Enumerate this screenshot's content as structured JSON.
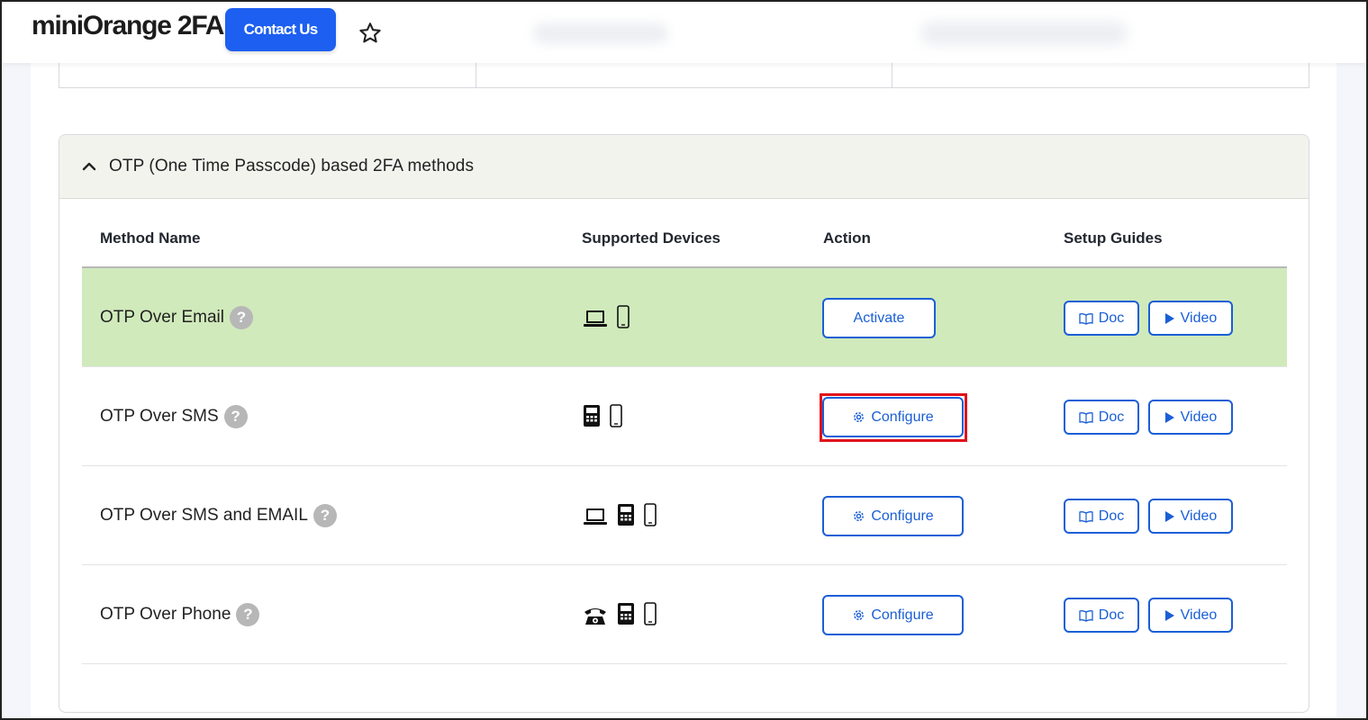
{
  "header": {
    "brand": "miniOrange 2FA",
    "contact_label": "Contact Us",
    "accent": "#1d5ff0"
  },
  "section": {
    "title": "OTP (One Time Passcode) based 2FA methods",
    "expanded": true
  },
  "table": {
    "columns": [
      "Method Name",
      "Supported Devices",
      "Action",
      "Setup Guides"
    ],
    "rows": [
      {
        "name": "OTP Over Email",
        "help": "?",
        "devices": [
          "laptop-icon",
          "smartphone-icon"
        ],
        "action": "Activate",
        "doc": "Doc",
        "video": "Video",
        "active": true
      },
      {
        "name": "OTP Over SMS",
        "help": "?",
        "devices": [
          "feature-phone-icon",
          "smartphone-icon"
        ],
        "action": "Configure",
        "doc": "Doc",
        "video": "Video",
        "active": false,
        "highlighted": true
      },
      {
        "name": "OTP Over SMS and EMAIL",
        "help": "?",
        "devices": [
          "laptop-icon",
          "feature-phone-icon",
          "smartphone-icon"
        ],
        "action": "Configure",
        "doc": "Doc",
        "video": "Video",
        "active": false
      },
      {
        "name": "OTP Over Phone",
        "help": "?",
        "devices": [
          "telephone-icon",
          "feature-phone-icon",
          "smartphone-icon"
        ],
        "action": "Configure",
        "doc": "Doc",
        "video": "Video",
        "active": false
      }
    ]
  },
  "colors": {
    "active_row": "#d0eabb",
    "button_outline": "#1a5fd6",
    "highlight": "#e0121b"
  }
}
